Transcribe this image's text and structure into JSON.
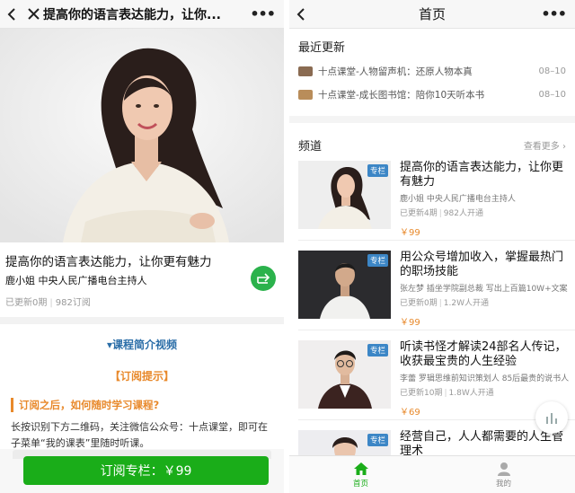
{
  "left": {
    "navbar": {
      "title": "提高你的语言表达能力，让你..."
    },
    "course": {
      "title": "提高你的语言表达能力，让你更有魅力",
      "author": "鹿小姐 中央人民广播电台主持人",
      "updated": "已更新0期",
      "subscribers": "982订阅"
    },
    "intro_link": "▾课程简介视频",
    "tip_heading": "【订阅提示】",
    "question": "订阅之后，如何随时学习课程?",
    "description": "长按识别下方二维码，关注微信公众号：十点课堂，即可在子菜单“我的课表”里随时听课。",
    "subscribe_label": "订阅专栏：￥99"
  },
  "right": {
    "navbar": {
      "title": "首页"
    },
    "recent": {
      "title": "最近更新",
      "items": [
        {
          "text": "十点课堂-人物留声机：还原人物本真",
          "date": "08–10",
          "color": "#8a6b52"
        },
        {
          "text": "十点课堂-成长图书馆：陪你10天听本书",
          "date": "08–10",
          "color": "#b98d5a"
        }
      ]
    },
    "channels": {
      "title": "频道",
      "see_more": "查看更多",
      "items": [
        {
          "badge": "专栏",
          "title": "提高你的语言表达能力，让你更有魅力",
          "author": "鹿小姐 中央人民广播电台主持人",
          "updated": "已更新4期",
          "subs": "982人开通",
          "price": "￥99"
        },
        {
          "badge": "专栏",
          "title": "用公众号增加收入，掌握最热门的职场技能",
          "author": "张左梦 插坐学院副总裁 写出上百篇10W+文案",
          "updated": "已更新0期",
          "subs": "1.2W人开通",
          "price": "￥99"
        },
        {
          "badge": "专栏",
          "title": "听读书怪才解读24部名人传记，收获最宝贵的人生经验",
          "author": "李蕾 罗辑思维前知识策划人 85后最贵的说书人",
          "updated": "已更新10期",
          "subs": "1.8W人开通",
          "price": "￥69"
        },
        {
          "badge": "专栏",
          "title": "经营自己，人人都需要的人生管理术",
          "author": "",
          "updated": "",
          "subs": "",
          "price": ""
        }
      ]
    },
    "tabs": [
      {
        "label": "首页",
        "active": true
      },
      {
        "label": "我的",
        "active": false
      }
    ]
  },
  "colors": {
    "accent_green": "#1aad19",
    "orange": "#e8892b",
    "link_blue": "#2b6ea8",
    "badge_blue": "#3c86c6"
  }
}
